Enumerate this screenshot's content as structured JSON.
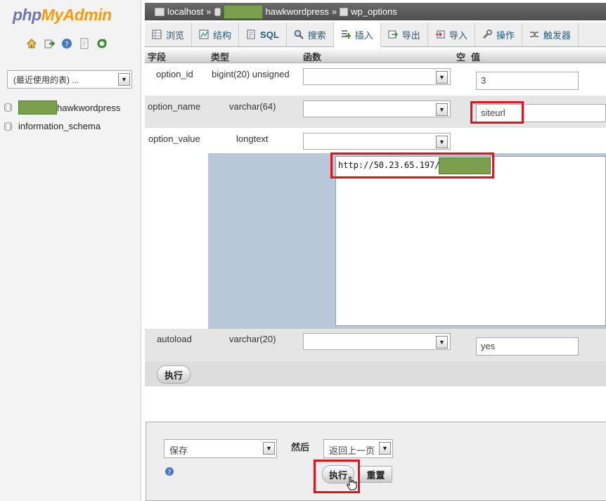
{
  "logo": {
    "part1": "php",
    "part2": "MyAdmin"
  },
  "sidebar": {
    "icons": [
      "home-icon",
      "logout-icon",
      "help-icon",
      "docs-icon",
      "reload-icon"
    ],
    "recent_select": "(最近使用的表) ...",
    "databases": [
      {
        "suffix": "hawkwordpress"
      },
      {
        "label": "information_schema"
      }
    ]
  },
  "breadcrumb": {
    "server": "localhost",
    "sep": "»",
    "db_suffix": "hawkwordpress",
    "table": "wp_options"
  },
  "tabs": [
    {
      "label": "浏览",
      "icon": "browse-icon"
    },
    {
      "label": "结构",
      "icon": "structure-icon"
    },
    {
      "label": "SQL",
      "icon": "sql-icon"
    },
    {
      "label": "搜索",
      "icon": "search-icon"
    },
    {
      "label": "插入",
      "icon": "insert-icon",
      "active": true
    },
    {
      "label": "导出",
      "icon": "export-icon"
    },
    {
      "label": "导入",
      "icon": "import-icon"
    },
    {
      "label": "操作",
      "icon": "operations-icon"
    },
    {
      "label": "触发器",
      "icon": "triggers-icon"
    }
  ],
  "headers": {
    "field": "字段",
    "type": "类型",
    "function": "函数",
    "null": "空",
    "value": "值"
  },
  "rows": [
    {
      "field": "option_id",
      "type": "bigint(20) unsigned",
      "value": "3"
    },
    {
      "field": "option_name",
      "type": "varchar(64)",
      "value": "siteurl"
    },
    {
      "field": "option_value",
      "type": "longtext",
      "value": "http://50.23.65.197/"
    },
    {
      "field": "autoload",
      "type": "varchar(20)",
      "value": "yes"
    }
  ],
  "go_label": "执行",
  "bottom": {
    "action": "保存",
    "then_label": "然后",
    "after": "返回上一页",
    "go": "执行",
    "reset": "重置"
  },
  "colors": {
    "highlight": "#e0141b",
    "redaction": "#7ba04d",
    "link": "#235a81"
  }
}
